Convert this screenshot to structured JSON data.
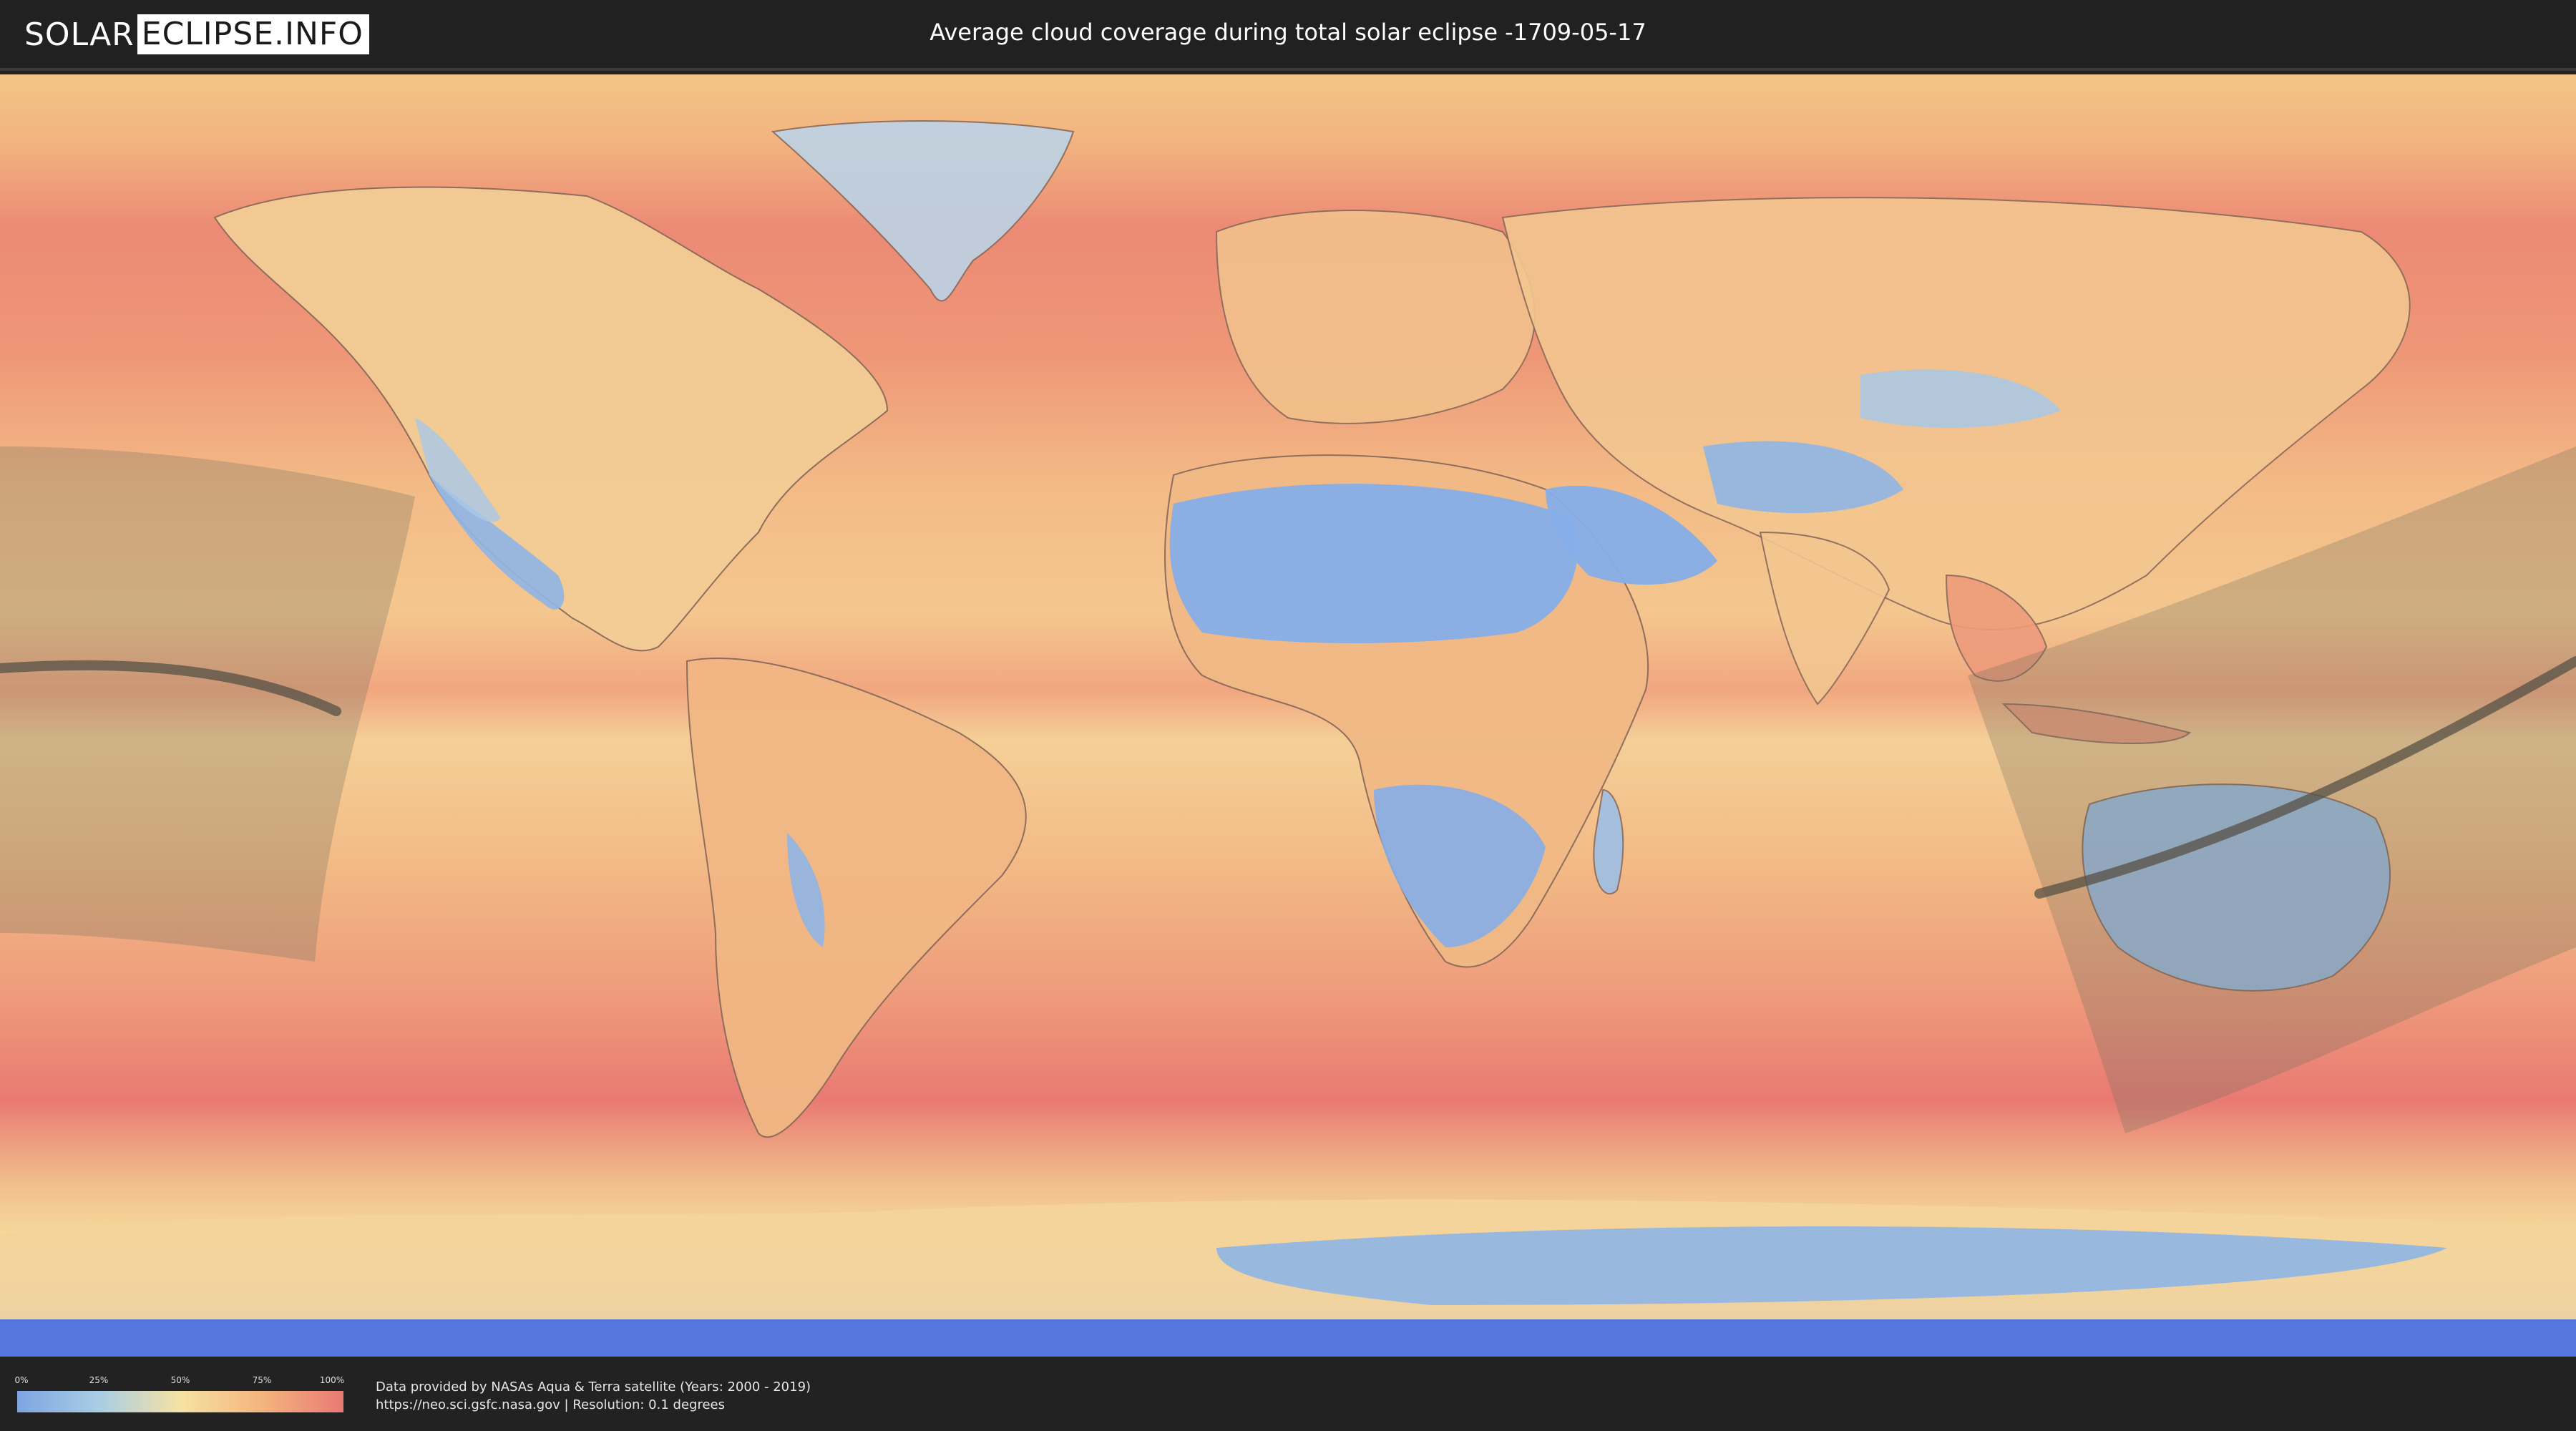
{
  "header": {
    "logo_part1": "SOLAR",
    "logo_part2": "ECLIPSE.INFO",
    "title": "Average cloud coverage during total solar eclipse -1709-05-17"
  },
  "legend": {
    "ticks": [
      "0%",
      "25%",
      "50%",
      "75%",
      "100%"
    ],
    "colors": [
      "#7ea5e2",
      "#a9cde4",
      "#f6e2a4",
      "#f3b57e",
      "#ea7975"
    ]
  },
  "credits": {
    "line1": "Data provided by NASAs Aqua & Terra satellite (Years: 2000 - 2019)",
    "line2": "https://neo.sci.gsfc.nasa.gov | Resolution: 0.1 degrees"
  },
  "map": {
    "projection": "equirectangular",
    "ocean_color": "#eb9a7b",
    "overlay": "eclipse path of totality"
  }
}
